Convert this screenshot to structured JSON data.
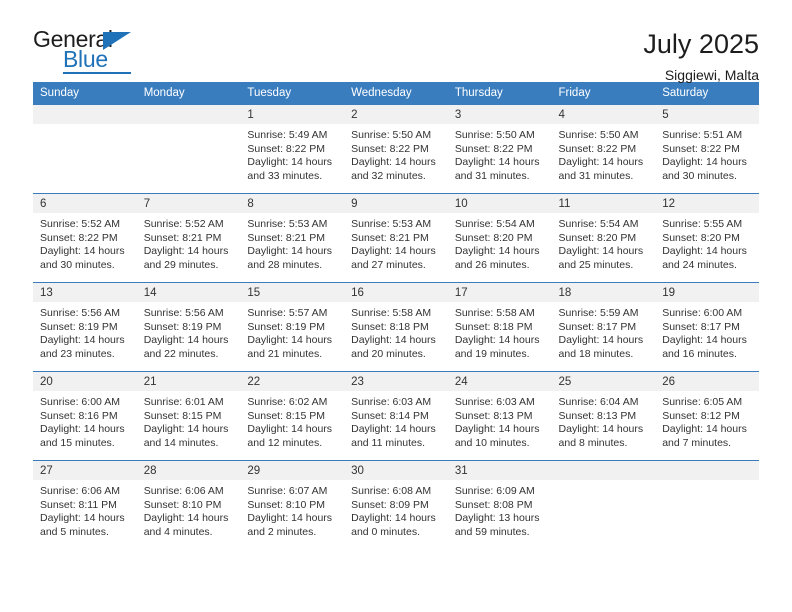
{
  "brand": {
    "name_top": "General",
    "name_bottom": "Blue"
  },
  "header": {
    "title": "July 2025",
    "location": "Siggiewi, Malta"
  },
  "colors": {
    "header_blue": "#3a7dbf",
    "brand_blue": "#1f72b8",
    "daynum_band": "#f1f1f1",
    "text": "#333333"
  },
  "weekday_headers": [
    "Sunday",
    "Monday",
    "Tuesday",
    "Wednesday",
    "Thursday",
    "Friday",
    "Saturday"
  ],
  "weeks": [
    [
      {
        "day": "",
        "sunrise": "",
        "sunset": "",
        "daylight1": "",
        "daylight2": ""
      },
      {
        "day": "",
        "sunrise": "",
        "sunset": "",
        "daylight1": "",
        "daylight2": ""
      },
      {
        "day": "1",
        "sunrise": "Sunrise: 5:49 AM",
        "sunset": "Sunset: 8:22 PM",
        "daylight1": "Daylight: 14 hours",
        "daylight2": "and 33 minutes."
      },
      {
        "day": "2",
        "sunrise": "Sunrise: 5:50 AM",
        "sunset": "Sunset: 8:22 PM",
        "daylight1": "Daylight: 14 hours",
        "daylight2": "and 32 minutes."
      },
      {
        "day": "3",
        "sunrise": "Sunrise: 5:50 AM",
        "sunset": "Sunset: 8:22 PM",
        "daylight1": "Daylight: 14 hours",
        "daylight2": "and 31 minutes."
      },
      {
        "day": "4",
        "sunrise": "Sunrise: 5:50 AM",
        "sunset": "Sunset: 8:22 PM",
        "daylight1": "Daylight: 14 hours",
        "daylight2": "and 31 minutes."
      },
      {
        "day": "5",
        "sunrise": "Sunrise: 5:51 AM",
        "sunset": "Sunset: 8:22 PM",
        "daylight1": "Daylight: 14 hours",
        "daylight2": "and 30 minutes."
      }
    ],
    [
      {
        "day": "6",
        "sunrise": "Sunrise: 5:52 AM",
        "sunset": "Sunset: 8:22 PM",
        "daylight1": "Daylight: 14 hours",
        "daylight2": "and 30 minutes."
      },
      {
        "day": "7",
        "sunrise": "Sunrise: 5:52 AM",
        "sunset": "Sunset: 8:21 PM",
        "daylight1": "Daylight: 14 hours",
        "daylight2": "and 29 minutes."
      },
      {
        "day": "8",
        "sunrise": "Sunrise: 5:53 AM",
        "sunset": "Sunset: 8:21 PM",
        "daylight1": "Daylight: 14 hours",
        "daylight2": "and 28 minutes."
      },
      {
        "day": "9",
        "sunrise": "Sunrise: 5:53 AM",
        "sunset": "Sunset: 8:21 PM",
        "daylight1": "Daylight: 14 hours",
        "daylight2": "and 27 minutes."
      },
      {
        "day": "10",
        "sunrise": "Sunrise: 5:54 AM",
        "sunset": "Sunset: 8:20 PM",
        "daylight1": "Daylight: 14 hours",
        "daylight2": "and 26 minutes."
      },
      {
        "day": "11",
        "sunrise": "Sunrise: 5:54 AM",
        "sunset": "Sunset: 8:20 PM",
        "daylight1": "Daylight: 14 hours",
        "daylight2": "and 25 minutes."
      },
      {
        "day": "12",
        "sunrise": "Sunrise: 5:55 AM",
        "sunset": "Sunset: 8:20 PM",
        "daylight1": "Daylight: 14 hours",
        "daylight2": "and 24 minutes."
      }
    ],
    [
      {
        "day": "13",
        "sunrise": "Sunrise: 5:56 AM",
        "sunset": "Sunset: 8:19 PM",
        "daylight1": "Daylight: 14 hours",
        "daylight2": "and 23 minutes."
      },
      {
        "day": "14",
        "sunrise": "Sunrise: 5:56 AM",
        "sunset": "Sunset: 8:19 PM",
        "daylight1": "Daylight: 14 hours",
        "daylight2": "and 22 minutes."
      },
      {
        "day": "15",
        "sunrise": "Sunrise: 5:57 AM",
        "sunset": "Sunset: 8:19 PM",
        "daylight1": "Daylight: 14 hours",
        "daylight2": "and 21 minutes."
      },
      {
        "day": "16",
        "sunrise": "Sunrise: 5:58 AM",
        "sunset": "Sunset: 8:18 PM",
        "daylight1": "Daylight: 14 hours",
        "daylight2": "and 20 minutes."
      },
      {
        "day": "17",
        "sunrise": "Sunrise: 5:58 AM",
        "sunset": "Sunset: 8:18 PM",
        "daylight1": "Daylight: 14 hours",
        "daylight2": "and 19 minutes."
      },
      {
        "day": "18",
        "sunrise": "Sunrise: 5:59 AM",
        "sunset": "Sunset: 8:17 PM",
        "daylight1": "Daylight: 14 hours",
        "daylight2": "and 18 minutes."
      },
      {
        "day": "19",
        "sunrise": "Sunrise: 6:00 AM",
        "sunset": "Sunset: 8:17 PM",
        "daylight1": "Daylight: 14 hours",
        "daylight2": "and 16 minutes."
      }
    ],
    [
      {
        "day": "20",
        "sunrise": "Sunrise: 6:00 AM",
        "sunset": "Sunset: 8:16 PM",
        "daylight1": "Daylight: 14 hours",
        "daylight2": "and 15 minutes."
      },
      {
        "day": "21",
        "sunrise": "Sunrise: 6:01 AM",
        "sunset": "Sunset: 8:15 PM",
        "daylight1": "Daylight: 14 hours",
        "daylight2": "and 14 minutes."
      },
      {
        "day": "22",
        "sunrise": "Sunrise: 6:02 AM",
        "sunset": "Sunset: 8:15 PM",
        "daylight1": "Daylight: 14 hours",
        "daylight2": "and 12 minutes."
      },
      {
        "day": "23",
        "sunrise": "Sunrise: 6:03 AM",
        "sunset": "Sunset: 8:14 PM",
        "daylight1": "Daylight: 14 hours",
        "daylight2": "and 11 minutes."
      },
      {
        "day": "24",
        "sunrise": "Sunrise: 6:03 AM",
        "sunset": "Sunset: 8:13 PM",
        "daylight1": "Daylight: 14 hours",
        "daylight2": "and 10 minutes."
      },
      {
        "day": "25",
        "sunrise": "Sunrise: 6:04 AM",
        "sunset": "Sunset: 8:13 PM",
        "daylight1": "Daylight: 14 hours",
        "daylight2": "and 8 minutes."
      },
      {
        "day": "26",
        "sunrise": "Sunrise: 6:05 AM",
        "sunset": "Sunset: 8:12 PM",
        "daylight1": "Daylight: 14 hours",
        "daylight2": "and 7 minutes."
      }
    ],
    [
      {
        "day": "27",
        "sunrise": "Sunrise: 6:06 AM",
        "sunset": "Sunset: 8:11 PM",
        "daylight1": "Daylight: 14 hours",
        "daylight2": "and 5 minutes."
      },
      {
        "day": "28",
        "sunrise": "Sunrise: 6:06 AM",
        "sunset": "Sunset: 8:10 PM",
        "daylight1": "Daylight: 14 hours",
        "daylight2": "and 4 minutes."
      },
      {
        "day": "29",
        "sunrise": "Sunrise: 6:07 AM",
        "sunset": "Sunset: 8:10 PM",
        "daylight1": "Daylight: 14 hours",
        "daylight2": "and 2 minutes."
      },
      {
        "day": "30",
        "sunrise": "Sunrise: 6:08 AM",
        "sunset": "Sunset: 8:09 PM",
        "daylight1": "Daylight: 14 hours",
        "daylight2": "and 0 minutes."
      },
      {
        "day": "31",
        "sunrise": "Sunrise: 6:09 AM",
        "sunset": "Sunset: 8:08 PM",
        "daylight1": "Daylight: 13 hours",
        "daylight2": "and 59 minutes."
      },
      {
        "day": "",
        "sunrise": "",
        "sunset": "",
        "daylight1": "",
        "daylight2": ""
      },
      {
        "day": "",
        "sunrise": "",
        "sunset": "",
        "daylight1": "",
        "daylight2": ""
      }
    ]
  ]
}
